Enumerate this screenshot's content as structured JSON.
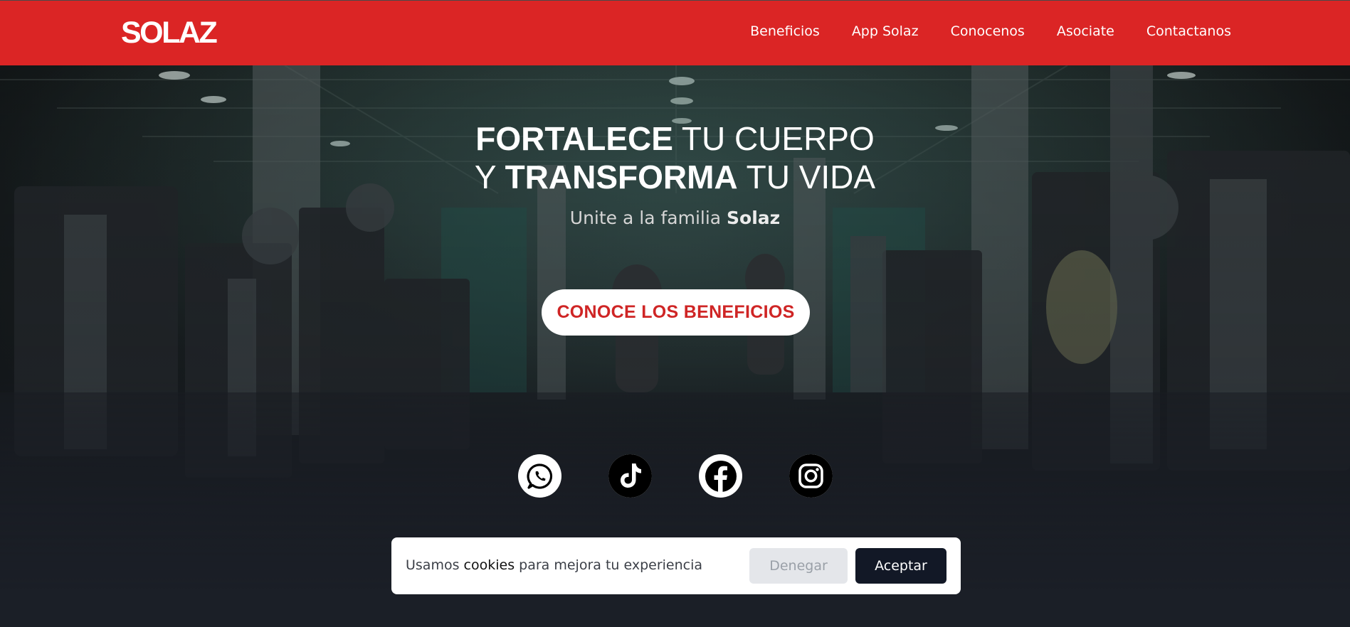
{
  "nav": {
    "logo": "SOLAZ",
    "links": [
      "Beneficios",
      "App Solaz",
      "Conocenos",
      "Asociate",
      "Contactanos"
    ]
  },
  "hero": {
    "title_line1_bold": "FORTALECE",
    "title_line1_rest": " TU CUERPO",
    "title_line2_start": "Y ",
    "title_line2_bold": "TRANSFORMA",
    "title_line2_rest": " TU VIDA",
    "subtitle_prefix": "Unite a la familia ",
    "subtitle_bold": "Solaz",
    "cta_label": "CONOCE LOS BENEFICIOS"
  },
  "social": {
    "icons": [
      "whatsapp-icon",
      "tiktok-icon",
      "facebook-icon",
      "instagram-icon"
    ]
  },
  "cookie_banner": {
    "text_prefix": "Usamos ",
    "text_bold": "cookies",
    "text_suffix": " para mejora tu experiencia",
    "deny_label": "Denegar",
    "accept_label": "Aceptar"
  },
  "colors": {
    "brand_red": "#db2525",
    "cta_text": "#cf2525",
    "accept_bg": "#121826",
    "page_bg": "#1b1f27"
  }
}
